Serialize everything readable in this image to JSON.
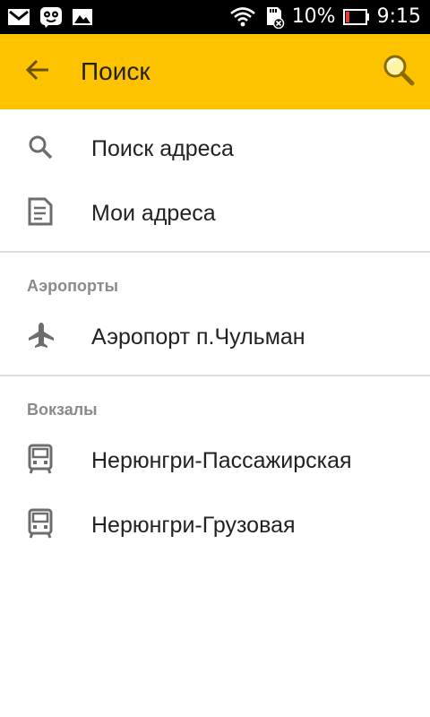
{
  "status_bar": {
    "battery_percent": "10%",
    "time": "9:15"
  },
  "app_bar": {
    "title": "Поиск",
    "back_icon": "arrow-back-icon",
    "action_icon": "magnifier-icon"
  },
  "top_items": [
    {
      "label": "Поиск адреса",
      "icon": "search-icon"
    },
    {
      "label": "Мои адреса",
      "icon": "document-icon"
    }
  ],
  "sections": [
    {
      "header": "Аэропорты",
      "items": [
        {
          "label": "Аэропорт п.Чульман",
          "icon": "airplane-icon"
        }
      ]
    },
    {
      "header": "Вокзалы",
      "items": [
        {
          "label": "Нерюнгри-Пассажирская",
          "icon": "train-icon"
        },
        {
          "label": "Нерюнгри-Грузовая",
          "icon": "train-icon"
        }
      ]
    }
  ],
  "colors": {
    "app_bar": "#fdc300",
    "icon_gray": "#6d6d6d",
    "section_header": "#8a8a8a"
  }
}
